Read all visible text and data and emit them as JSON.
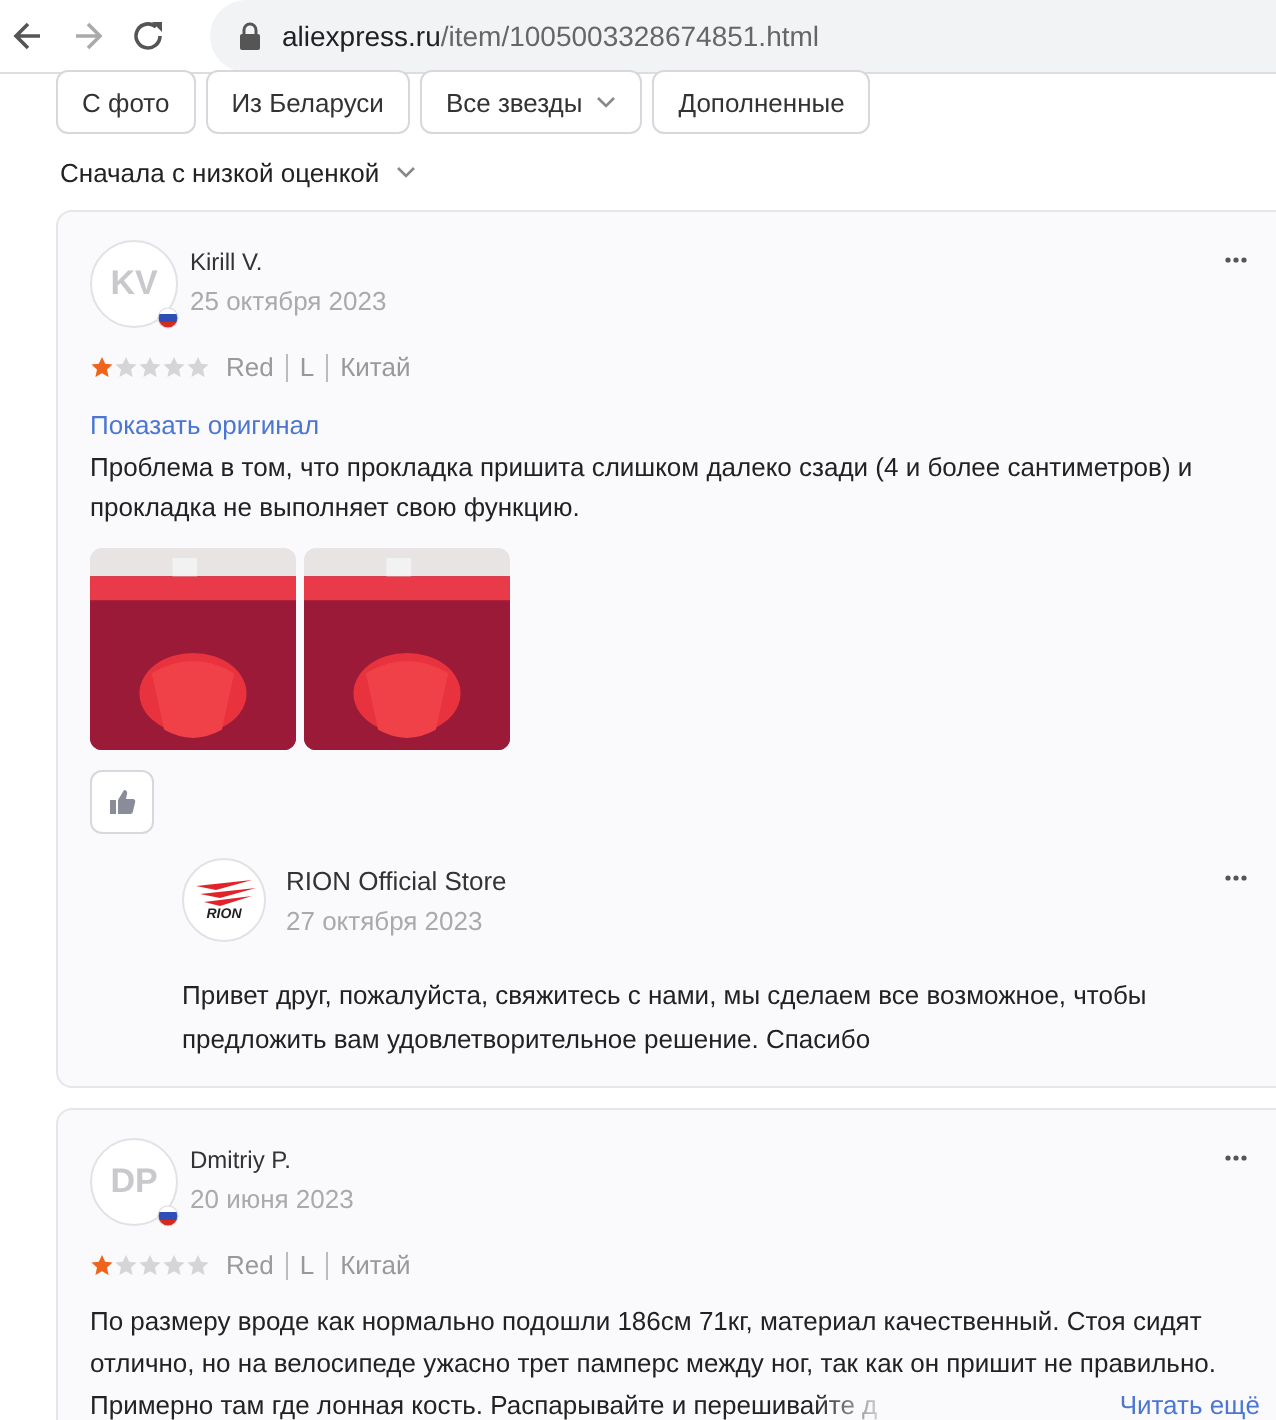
{
  "browser": {
    "url_host": "aliexpress.ru",
    "url_path": "/item/1005003328674851.html"
  },
  "filters": [
    {
      "label": "С фото",
      "dropdown": false
    },
    {
      "label": "Из Беларуси",
      "dropdown": false
    },
    {
      "label": "Все звезды",
      "dropdown": true
    },
    {
      "label": "Дополненные",
      "dropdown": false
    }
  ],
  "sort": {
    "label": "Сначала с низкой оценкой"
  },
  "reviews": [
    {
      "initials": "KV",
      "author": "Kirill V.",
      "date": "25 октября 2023",
      "stars": 1,
      "attributes": [
        "Red",
        "L",
        "Китай"
      ],
      "show_original": "Показать оригинал",
      "text": "Проблема в том, что прокладка пришита слишком далеко сзади (4 и более сантиметров) и прокладка не выполняет свою функцию.",
      "photos": [
        {
          "kind": "picture"
        },
        {
          "kind": "picture"
        }
      ],
      "like": true,
      "reply": {
        "logo_text": "RION",
        "author": "RION Official Store",
        "date": "27 октября 2023",
        "text": "Привет друг, пожалуйста, свяжитесь с нами, мы сделаем все возможное, чтобы предложить вам удовлетворительное решение. Спасибо"
      }
    },
    {
      "initials": "DP",
      "author": "Dmitriy P.",
      "date": "20 июня 2023",
      "stars": 1,
      "attributes": [
        "Red",
        "L",
        "Китай"
      ],
      "text": "По размеру вроде как нормально подошли 186см 71кг, материал качественный. Стоя сидят отлично, но на велосипеде ужасно трет памперс между ног, так как он пришит не правильно.",
      "text_faded": "Примерно там где лонная кость. Распарывайте и перешивайте д",
      "read_more": "Читать ещё"
    }
  ]
}
